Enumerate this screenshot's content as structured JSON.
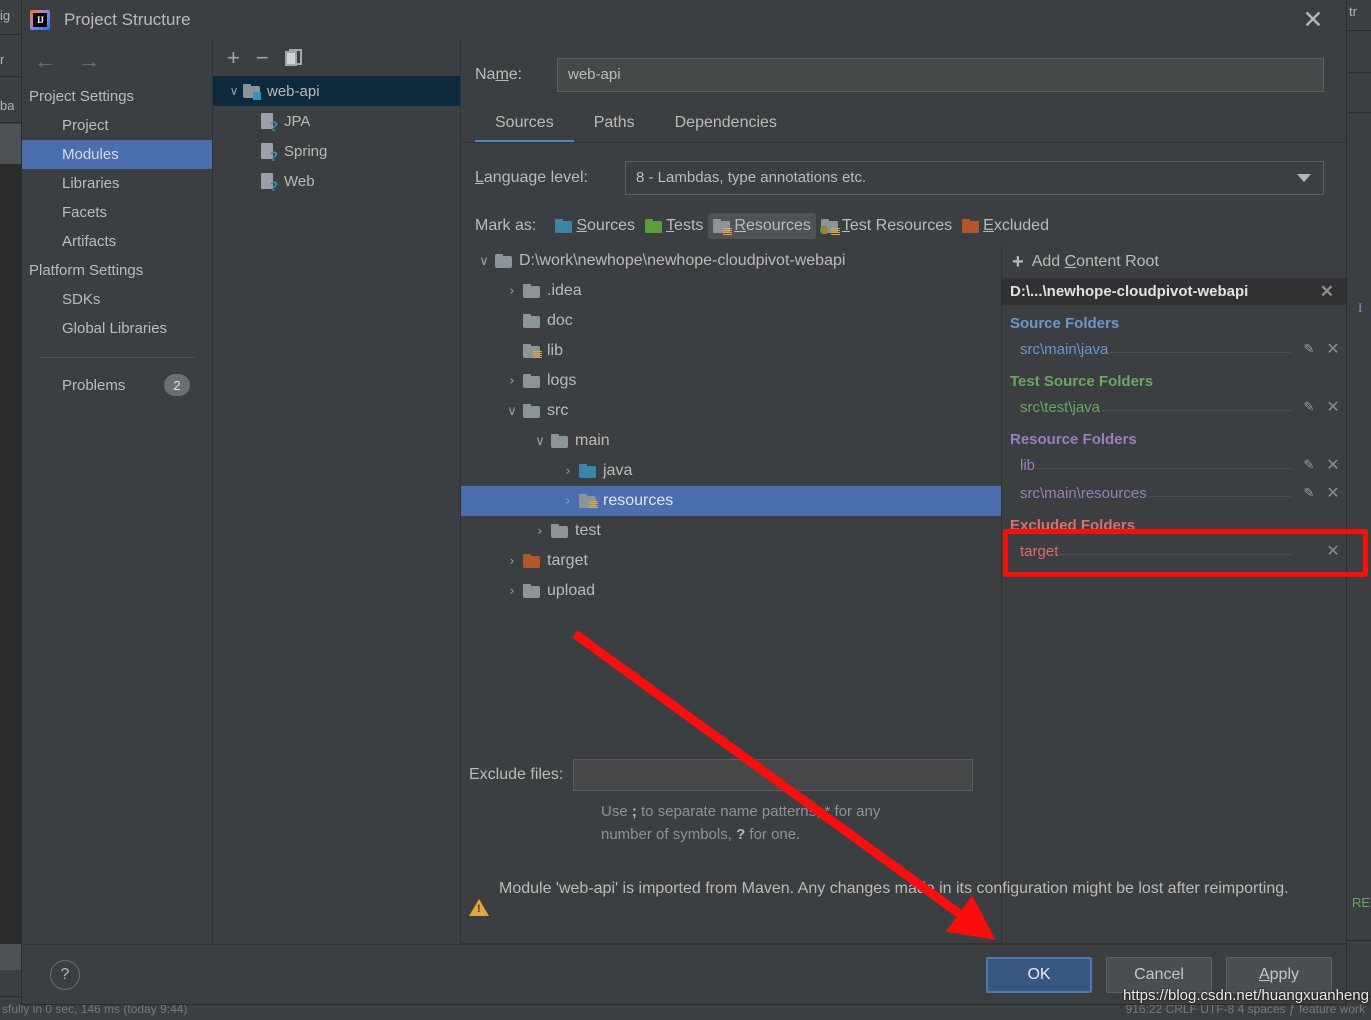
{
  "background": {
    "fragments": [
      "ig",
      "r",
      "ba",
      "tr",
      "I",
      "RE"
    ],
    "status_left": "sfully in 0 sec, 146 ms (today 9:44)",
    "status_right": "916:22   CRLF   UTF-8   4 spaces   ƒ feature work"
  },
  "titlebar": {
    "app_glyph": "IJ",
    "title": "Project Structure",
    "close": "✕"
  },
  "nav": {
    "back": "←",
    "forward": "→",
    "groups": [
      {
        "label": "Project Settings",
        "items": [
          "Project",
          "Modules",
          "Libraries",
          "Facets",
          "Artifacts"
        ]
      },
      {
        "label": "Platform Settings",
        "items": [
          "SDKs",
          "Global Libraries"
        ]
      }
    ],
    "selected": "Modules",
    "problems_label": "Problems",
    "problems_count": "2"
  },
  "modules_panel": {
    "toolbar": {
      "add": "+",
      "remove": "−",
      "copy": "copy-icon"
    },
    "tree": [
      {
        "label": "web-api",
        "type": "module",
        "chevron": "∨",
        "selected": true,
        "indent": 0
      },
      {
        "label": "JPA",
        "type": "facet",
        "chevron": "",
        "selected": false,
        "indent": 1
      },
      {
        "label": "Spring",
        "type": "facet",
        "chevron": "",
        "selected": false,
        "indent": 1
      },
      {
        "label": "Web",
        "type": "facet",
        "chevron": "",
        "selected": false,
        "indent": 1
      }
    ]
  },
  "editor": {
    "name_label_pre": "Na",
    "name_label_mnemonic": "m",
    "name_label_post": "e:",
    "name_value": "web-api",
    "tabs": [
      {
        "label": "Sources",
        "active": true
      },
      {
        "label": "Paths",
        "active": false
      },
      {
        "label": "Dependencies",
        "active": false
      }
    ],
    "language_level_label_pre": "L",
    "language_level_label_post": "anguage level:",
    "language_level_value": "8 - Lambdas, type annotations etc.",
    "mark_as_label": "Mark as:",
    "mark_as_buttons": [
      {
        "pre": "",
        "mn": "S",
        "post": "ources",
        "icon": "folder-sources-icon",
        "active": false
      },
      {
        "pre": "",
        "mn": "T",
        "post": "ests",
        "icon": "folder-tests-icon",
        "active": false
      },
      {
        "pre": "",
        "mn": "R",
        "post": "esources",
        "icon": "folder-resources-icon",
        "active": true
      },
      {
        "pre": "",
        "mn": "T",
        "post": "est Resources",
        "icon": "folder-test-resources-icon",
        "active": false
      },
      {
        "pre": "",
        "mn": "E",
        "post": "xcluded",
        "icon": "folder-excluded-icon",
        "active": false
      }
    ],
    "exclude_files_label": "Exclude files:",
    "exclude_files_value": "",
    "exclude_hint_1_a": "Use ",
    "exclude_hint_1_b": ";",
    "exclude_hint_1_c": " to separate name patterns, * for any",
    "exclude_hint_2_a": "number of symbols, ",
    "exclude_hint_2_b": "?",
    "exclude_hint_2_c": " for one.",
    "warning": "Module 'web-api' is imported from Maven. Any changes made in its configuration might be lost after reimporting."
  },
  "file_tree": [
    {
      "label": "D:\\work\\newhope\\newhope-cloudpivot-webapi",
      "chevron": "∨",
      "depth": 0,
      "icon": "folder-plain-icon",
      "selected": false
    },
    {
      "label": ".idea",
      "chevron": "›",
      "depth": 1,
      "icon": "folder-plain-icon",
      "selected": false
    },
    {
      "label": "doc",
      "chevron": "",
      "depth": 1,
      "icon": "folder-plain-icon",
      "selected": false
    },
    {
      "label": "lib",
      "chevron": "",
      "depth": 1,
      "icon": "folder-resources-icon",
      "selected": false
    },
    {
      "label": "logs",
      "chevron": "›",
      "depth": 1,
      "icon": "folder-plain-icon",
      "selected": false
    },
    {
      "label": "src",
      "chevron": "∨",
      "depth": 1,
      "icon": "folder-plain-icon",
      "selected": false
    },
    {
      "label": "main",
      "chevron": "∨",
      "depth": 2,
      "icon": "folder-plain-icon",
      "selected": false
    },
    {
      "label": "java",
      "chevron": "›",
      "depth": 3,
      "icon": "folder-sources-icon",
      "selected": false
    },
    {
      "label": "resources",
      "chevron": "›",
      "depth": 3,
      "icon": "folder-resources-icon",
      "selected": true
    },
    {
      "label": "test",
      "chevron": "›",
      "depth": 2,
      "icon": "folder-plain-icon",
      "selected": false
    },
    {
      "label": "target",
      "chevron": "›",
      "depth": 1,
      "icon": "folder-excluded-icon",
      "selected": false
    },
    {
      "label": "upload",
      "chevron": "›",
      "depth": 1,
      "icon": "folder-plain-icon",
      "selected": false
    }
  ],
  "content_roots": {
    "add_label_pre": "Add ",
    "add_label_mn": "C",
    "add_label_post": "ontent Root",
    "root_path": "D:\\...\\newhope-cloudpivot-webapi",
    "root_close": "✕",
    "groups": [
      {
        "title": "Source Folders",
        "kind": "src",
        "items": [
          {
            "name": "src\\main\\java",
            "edit": true,
            "remove": true
          }
        ]
      },
      {
        "title": "Test Source Folders",
        "kind": "tst",
        "items": [
          {
            "name": "src\\test\\java",
            "edit": true,
            "remove": true
          }
        ]
      },
      {
        "title": "Resource Folders",
        "kind": "res",
        "items": [
          {
            "name": "lib",
            "edit": true,
            "remove": true
          },
          {
            "name": "src\\main\\resources",
            "edit": true,
            "remove": true,
            "highlighted": true
          }
        ]
      },
      {
        "title": "Excluded Folders",
        "kind": "exc",
        "items": [
          {
            "name": "target",
            "edit": false,
            "remove": true
          }
        ]
      }
    ]
  },
  "footer": {
    "help": "?",
    "ok": "OK",
    "cancel": "Cancel",
    "apply_mn": "A",
    "apply_rest": "pply"
  },
  "annotations": {
    "watermark": "https://blog.csdn.net/huangxuanheng",
    "highlight_color": "#fb0d0d"
  }
}
